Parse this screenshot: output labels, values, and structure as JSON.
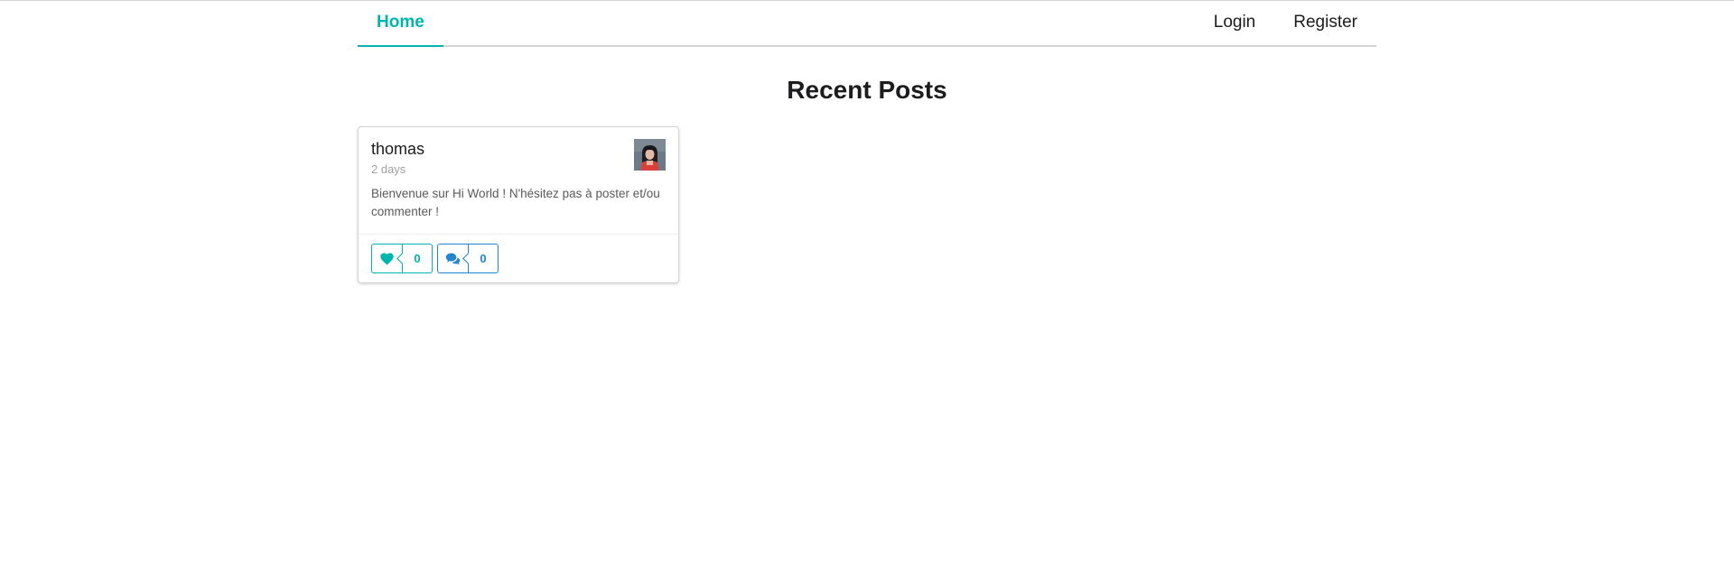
{
  "nav": {
    "home_label": "Home",
    "login_label": "Login",
    "register_label": "Register"
  },
  "page": {
    "title": "Recent Posts"
  },
  "posts": [
    {
      "author": "thomas",
      "time": "2 days",
      "text": "Bienvenue sur Hi World ! N'hésitez pas à poster et/ou commenter !",
      "likes": "0",
      "comments": "0",
      "avatar_icon": "user-avatar-photo"
    }
  ],
  "icons": {
    "like": "heart-icon",
    "comment": "comments-icon"
  },
  "colors": {
    "accent": "#00b5ad",
    "comment": "#2185d0",
    "border": "#d4d4d5",
    "meta": "#a0a0a0"
  }
}
